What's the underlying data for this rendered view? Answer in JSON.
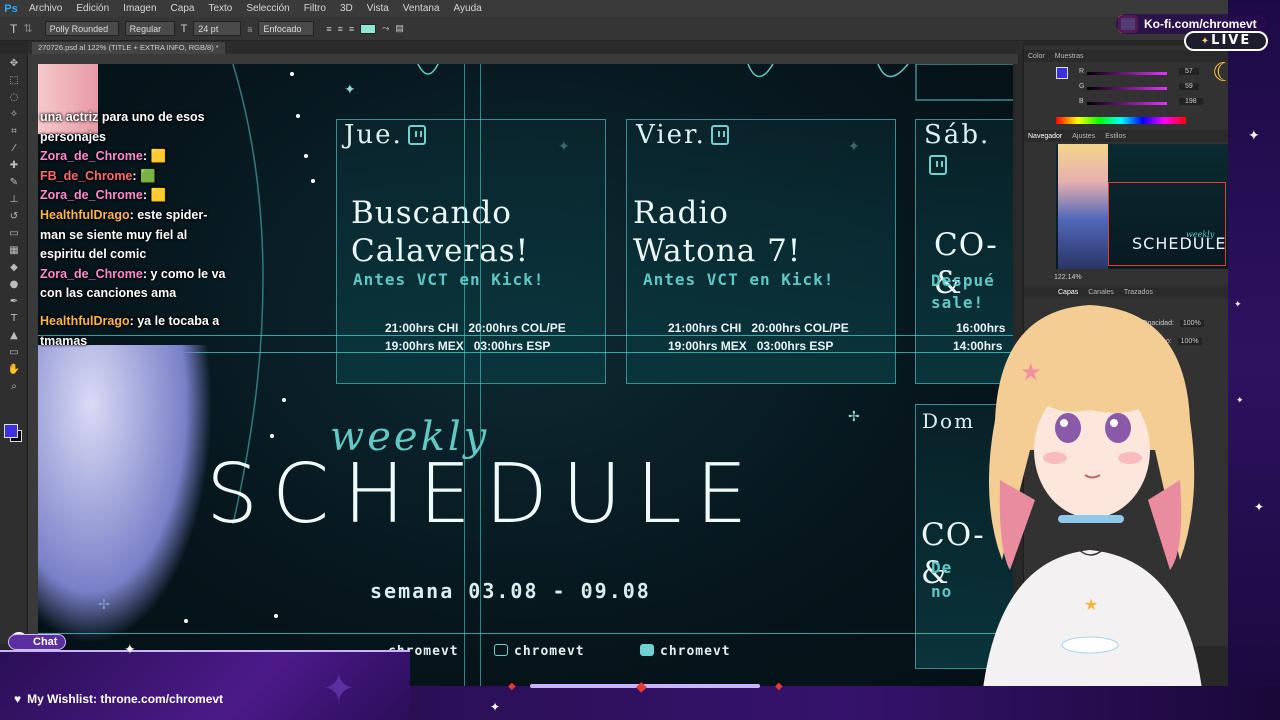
{
  "menubar": {
    "logo": "Ps",
    "items": [
      "Archivo",
      "Edición",
      "Imagen",
      "Capa",
      "Texto",
      "Selección",
      "Filtro",
      "3D",
      "Vista",
      "Ventana",
      "Ayuda"
    ]
  },
  "options": {
    "font_family": "Polly Rounded",
    "font_style": "Regular",
    "font_size": "24 pt",
    "aa_label": "a",
    "antialias": "Enfocado"
  },
  "document_tab": "270726.psd al 122% (TITLE + EXTRA INFO, RGB/8) *",
  "chat_messages": [
    {
      "user": "",
      "text": "una actriz para uno de esos personajes"
    },
    {
      "user": "Zora_de_Chrome",
      "text": ""
    },
    {
      "user": "FB_de_Chrome",
      "text": ""
    },
    {
      "user": "Zora_de_Chrome",
      "text": ""
    },
    {
      "user": "HealthfulDrago",
      "text": "este spider-man se siente muy fiel al espiritu del comic"
    },
    {
      "user": "Zora_de_Chrome",
      "text": "y como le va con las canciones ama"
    },
    {
      "user": "HealthfulDrago",
      "text": "ya le tocaba a tmamas"
    }
  ],
  "schedule": {
    "cards": [
      {
        "day": "Jue.",
        "title_l1": "Buscando",
        "title_l2": "Calaveras!",
        "sub": "Antes VCT en Kick!",
        "t1a": "21:00hrs CHI",
        "t1b": "20:00hrs COL/PE",
        "t2a": "19:00hrs MEX",
        "t2b": "03:00hrs ESP"
      },
      {
        "day": "Vier.",
        "title_l1": "Radio",
        "title_l2": "Watona 7!",
        "sub": "Antes VCT en Kick!",
        "t1a": "21:00hrs CHI",
        "t1b": "20:00hrs COL/PE",
        "t2a": "19:00hrs MEX",
        "t2b": "03:00hrs ESP"
      },
      {
        "day": "Sáb.",
        "title_l1": "CO-&",
        "sub_l1": "Despué",
        "sub_l2": "sale!",
        "t1": "16:00hrs",
        "t2": "14:00hrs"
      },
      {
        "day": "Dom",
        "title_l1": "CO-&",
        "sub_l1": "De",
        "sub_l2": "no"
      }
    ],
    "weekly": "weekly",
    "heading": "SCHEDULE",
    "week": "semana 03.08 - 09.08",
    "social_1": "chromevt",
    "social_2": "chromevt",
    "social_3": "chromevt"
  },
  "panels": {
    "tabs_top": [
      "Color",
      "Muestras"
    ],
    "rgb": {
      "r_label": "R",
      "r": "57",
      "g_label": "G",
      "g": "59",
      "b_label": "B",
      "b": "198"
    },
    "tabs_nav": [
      "Navegador",
      "Ajustes",
      "Estilos"
    ],
    "nav_zoom": "122.14%",
    "nav_weekly": "weekly",
    "nav_sched": "SCHEDULE",
    "tabs_layers": [
      "Capas",
      "Canales",
      "Trazados"
    ],
    "opacity_label": "Opacidad:",
    "opacity": "100%",
    "fill_label": "Relleno:",
    "fill": "100%"
  },
  "overlay": {
    "kofi": "Ko-fi.com/chromevt",
    "live": "LIVE",
    "chat_button": "Chat",
    "wishlist": "My Wishlist: throne.com/chromevt"
  },
  "colors": {
    "accent": "#3fd4d0",
    "foreground": "#3b2fe0",
    "live_border": "#ffffff",
    "frame_purple": "#35136c"
  }
}
